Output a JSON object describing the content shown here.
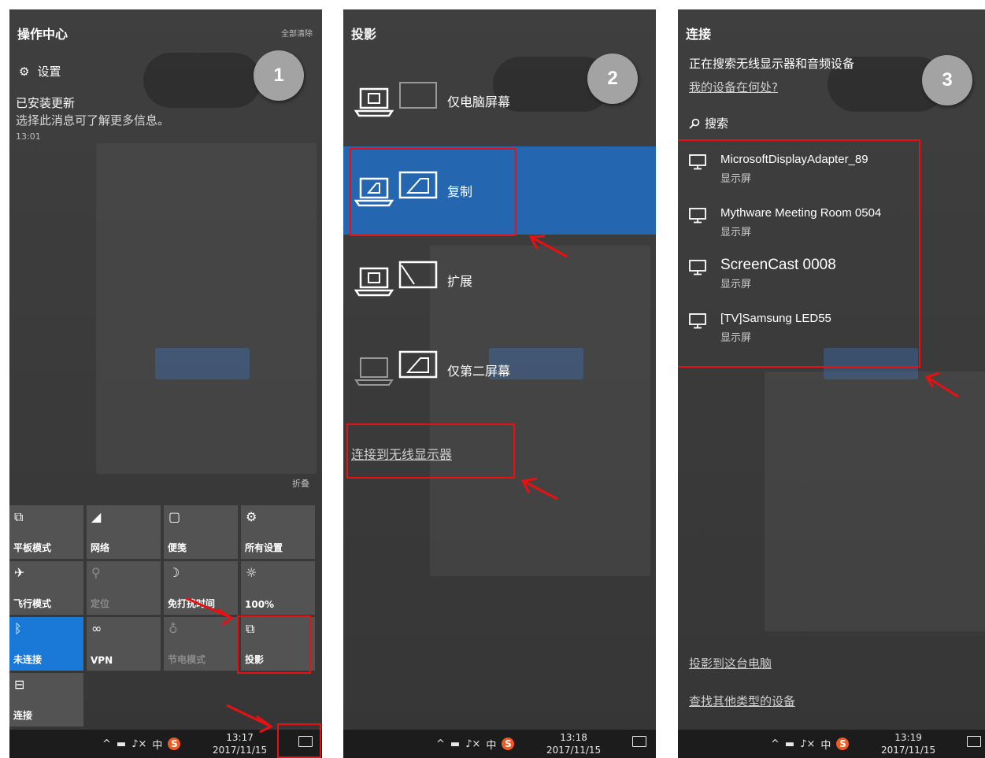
{
  "panel1": {
    "title": "操作中心",
    "clear_all": "全部清除",
    "settings_label": "设置",
    "notification": {
      "title": "已安装更新",
      "body": "选择此消息可了解更多信息。",
      "time": "13:01"
    },
    "collapse": "折叠",
    "tiles": [
      {
        "label": "平板模式",
        "icon": "tablet-mode-icon",
        "glyph": "⧉"
      },
      {
        "label": "网络",
        "icon": "network-icon",
        "glyph": "◢"
      },
      {
        "label": "便笺",
        "icon": "note-icon",
        "glyph": "▢"
      },
      {
        "label": "所有设置",
        "icon": "settings-icon",
        "glyph": "⚙"
      },
      {
        "label": "飞行模式",
        "icon": "airplane-icon",
        "glyph": "✈"
      },
      {
        "label": "定位",
        "icon": "location-icon",
        "glyph": "⚲"
      },
      {
        "label": "免打扰时间",
        "icon": "quiet-hours-icon",
        "glyph": "☽"
      },
      {
        "label": "100%",
        "icon": "brightness-icon",
        "glyph": "☼"
      },
      {
        "label": "未连接",
        "icon": "bluetooth-icon",
        "glyph": "ᛒ"
      },
      {
        "label": "VPN",
        "icon": "vpn-icon",
        "glyph": "∞"
      },
      {
        "label": "节电模式",
        "icon": "battery-saver-icon",
        "glyph": "♁"
      },
      {
        "label": "投影",
        "icon": "project-icon",
        "glyph": "⧉"
      },
      {
        "label": "连接",
        "icon": "connect-icon",
        "glyph": "⊟"
      }
    ],
    "taskbar": {
      "ime": "中",
      "time": "13:17",
      "date": "2017/11/15"
    },
    "step": "1"
  },
  "panel2": {
    "title": "投影",
    "options": [
      "仅电脑屏幕",
      "复制",
      "扩展",
      "仅第二屏幕"
    ],
    "wireless_link": "连接到无线显示器",
    "taskbar": {
      "ime": "中",
      "time": "13:18",
      "date": "2017/11/15"
    },
    "step": "2"
  },
  "panel3": {
    "title": "连接",
    "status": "正在搜索无线显示器和音频设备",
    "where_link": "我的设备在何处?",
    "search_label": "搜索",
    "devices": [
      {
        "name": "MicrosoftDisplayAdapter_89",
        "type": "显示屏"
      },
      {
        "name": "Mythware Meeting Room 0504",
        "type": "显示屏"
      },
      {
        "name": "ScreenCast 0008",
        "type": "显示屏"
      },
      {
        "name": "[TV]Samsung LED55",
        "type": "显示屏"
      }
    ],
    "project_to_pc": "投影到这台电脑",
    "find_other": "查找其他类型的设备",
    "taskbar": {
      "ime": "中",
      "time": "13:19",
      "date": "2017/11/15"
    },
    "step": "3"
  },
  "colors": {
    "accent_blue": "#1a78d6",
    "selected_blue": "#2467b0",
    "highlight_red": "#e81010"
  }
}
